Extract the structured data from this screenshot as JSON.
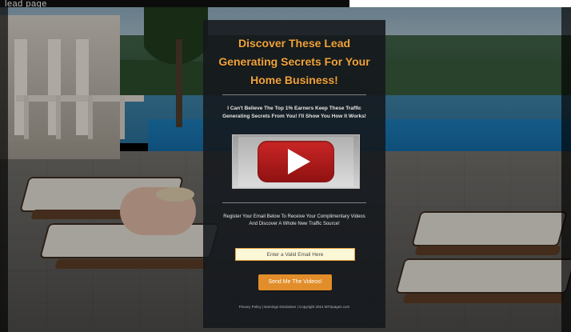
{
  "header": {
    "watermark_text": "lead page"
  },
  "panel": {
    "headline": "Discover These Lead Generating Secrets For Your Home Business!",
    "subheadline": "I Can't Believe The Top 1% Earners Keep These Traffic Generating Secrets From You! I'll Show You How It Works!",
    "video": {
      "icon": "play-icon"
    },
    "register_text": "Register Your Email Below To Receive Your Complimentary Videos And Discover A Whole New Traffic Source!",
    "email_field": {
      "placeholder": "Enter a Valid Email Here"
    },
    "submit_button": {
      "label": "Send Me The Videos!"
    },
    "footer_text": "Privacy Policy | Earnings Disclaimer | Copyright 2014 MTSpages.com"
  },
  "colors": {
    "accent": "#f2a33a",
    "button": "#e18d2a",
    "panel_bg": "#14181c",
    "play_button": "#cc2626"
  }
}
